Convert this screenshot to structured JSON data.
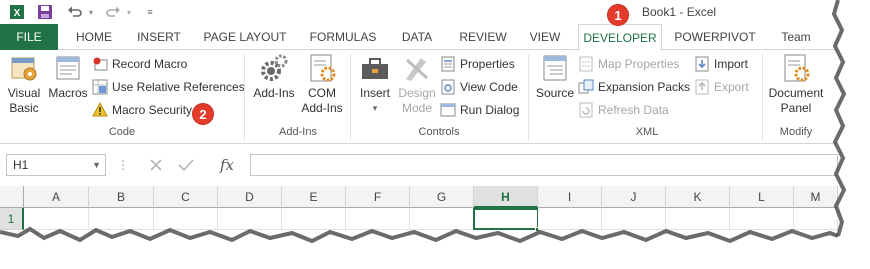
{
  "window": {
    "title": "Book1 - Excel"
  },
  "qat": {
    "icons": [
      "excel-icon",
      "save-icon",
      "undo-icon",
      "redo-icon",
      "customize-qat-icon"
    ]
  },
  "tabs": [
    {
      "label": "FILE"
    },
    {
      "label": "HOME"
    },
    {
      "label": "INSERT"
    },
    {
      "label": "PAGE LAYOUT"
    },
    {
      "label": "FORMULAS"
    },
    {
      "label": "DATA"
    },
    {
      "label": "REVIEW"
    },
    {
      "label": "VIEW"
    },
    {
      "label": "DEVELOPER"
    },
    {
      "label": "POWERPIVOT"
    },
    {
      "label": "Team"
    }
  ],
  "ribbon": {
    "code": {
      "label": "Code",
      "visual_basic_1": "Visual",
      "visual_basic_2": "Basic",
      "macros": "Macros",
      "record_macro": "Record Macro",
      "use_relative": "Use Relative References",
      "macro_security": "Macro Security"
    },
    "addins": {
      "label": "Add-Ins",
      "addins": "Add-Ins",
      "com_1": "COM",
      "com_2": "Add-Ins"
    },
    "controls": {
      "label": "Controls",
      "insert": "Insert",
      "design_1": "Design",
      "design_2": "Mode",
      "properties": "Properties",
      "view_code": "View Code",
      "run_dialog": "Run Dialog"
    },
    "xml": {
      "label": "XML",
      "source": "Source",
      "map_properties": "Map Properties",
      "expansion_packs": "Expansion Packs",
      "refresh_data": "Refresh Data",
      "import": "Import",
      "export": "Export"
    },
    "modify": {
      "label": "Modify",
      "document_1": "Document",
      "document_2": "Panel"
    }
  },
  "callouts": [
    "1",
    "2"
  ],
  "formula_bar": {
    "name_box": "H1",
    "fx": "fx",
    "formula": ""
  },
  "grid": {
    "columns": [
      "A",
      "B",
      "C",
      "D",
      "E",
      "F",
      "G",
      "H",
      "I",
      "J",
      "K",
      "L",
      "M"
    ],
    "rows": [
      "1"
    ],
    "selected_cell": "H1"
  },
  "colors": {
    "excel_green": "#217346",
    "callout_red": "#e53b2c"
  }
}
